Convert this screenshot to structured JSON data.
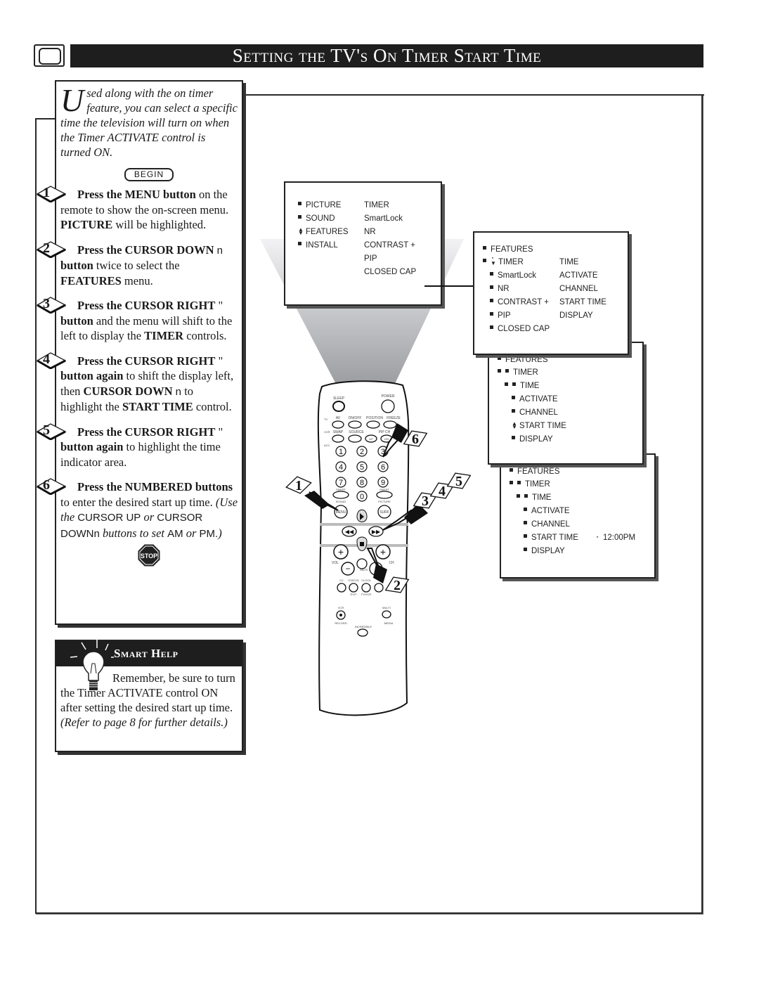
{
  "header": {
    "title": "Setting the TV's On Timer Start Time",
    "icon": "tv-icon"
  },
  "intro": {
    "dropcap": "U",
    "text": "sed along with the on timer feature, you can select a specific time the television will turn on when the Timer ACTIVATE control is turned ON.",
    "begin_label": "BEGIN"
  },
  "steps": [
    {
      "number": "1",
      "segments": [
        {
          "b": "Press the MENU button"
        },
        {
          "t": " on the remote to show the on-screen menu. "
        },
        {
          "b": "PICTURE"
        },
        {
          "t": " will be highlighted."
        }
      ]
    },
    {
      "number": "2",
      "segments": [
        {
          "b": "Press the CURSOR DOWN"
        },
        {
          "s": " n "
        },
        {
          "b": "button"
        },
        {
          "t": " twice to select the "
        },
        {
          "b": "FEATURES"
        },
        {
          "t": " menu."
        }
      ]
    },
    {
      "number": "3",
      "segments": [
        {
          "b": "Press the CURSOR RIGHT"
        },
        {
          "t": " \"      "
        },
        {
          "b": "button"
        },
        {
          "t": " and the menu will shift to the left to display the "
        },
        {
          "b": "TIMER"
        },
        {
          "t": " controls."
        }
      ]
    },
    {
      "number": "4",
      "segments": [
        {
          "b": "Press the CURSOR RIGHT"
        },
        {
          "t": " \"      "
        },
        {
          "b": "button again"
        },
        {
          "t": " to shift the display left, then "
        },
        {
          "b": "CURSOR DOWN"
        },
        {
          "s": " n "
        },
        {
          "t": " to highlight the "
        },
        {
          "b": "START TIME"
        },
        {
          "t": " control."
        }
      ]
    },
    {
      "number": "5",
      "segments": [
        {
          "b": "Press the CURSOR RIGHT"
        },
        {
          "t": " \"      "
        },
        {
          "b": "button again"
        },
        {
          "t": " to highlight the time indicator area."
        }
      ]
    },
    {
      "number": "6",
      "segments": [
        {
          "b": "Press the NUMBERED buttons"
        },
        {
          "t": " to enter the desired start up time. "
        },
        {
          "i": "(Use the "
        },
        {
          "s": "CURSOR UP"
        },
        {
          "i": "    or "
        },
        {
          "s": "CURSOR DOWNn"
        },
        {
          "i": "  buttons to set "
        },
        {
          "s": "AM"
        },
        {
          "i": " or "
        },
        {
          "s": "PM."
        },
        {
          "i": ")"
        }
      ]
    }
  ],
  "stop_label": "STOP",
  "smart_help": {
    "title": "Smart Help",
    "segments": [
      {
        "t": "Remember, be sure to turn the Timer ACTIVATE control ON after setting the desired start up time. "
      },
      {
        "i": "(Refer to page 8 for further details.)"
      }
    ]
  },
  "menus": {
    "main": {
      "left": [
        "PICTURE",
        "SOUND",
        "FEATURES",
        "INSTALL"
      ],
      "right": [
        "TIMER",
        "SmartLock",
        "NR",
        "CONTRAST +",
        "PIP",
        "CLOSED CAP"
      ],
      "selected": "FEATURES"
    },
    "features": {
      "header": "FEATURES",
      "left": [
        "TIMER",
        "SmartLock",
        "NR",
        "CONTRAST +",
        "PIP",
        "CLOSED CAP"
      ],
      "right": [
        "TIME",
        "ACTIVATE",
        "CHANNEL",
        "START TIME",
        "DISPLAY"
      ],
      "selected": "TIMER"
    },
    "timer": {
      "path": [
        "FEATURES",
        "TIMER"
      ],
      "items": [
        "TIME",
        "ACTIVATE",
        "CHANNEL",
        "START TIME",
        "DISPLAY"
      ],
      "selected": "START TIME"
    },
    "start_time": {
      "path": [
        "FEATURES",
        "TIMER"
      ],
      "items": [
        "TIME",
        "ACTIVATE",
        "CHANNEL",
        "START TIME",
        "DISPLAY"
      ],
      "selected": "START TIME",
      "value": "12:00PM"
    }
  },
  "remote": {
    "labels": {
      "sleep": "SLEEP",
      "power": "POWER",
      "tv": "TV",
      "vcr": "VCR",
      "acc": "ACC",
      "av": "AV",
      "onoff": "ON/OFF",
      "position": "POSITION",
      "freeze": "FREEZE",
      "swap": "SWAP",
      "source": "SOURCE",
      "pipch": "PIP CH",
      "up": "UP",
      "dn": "DN",
      "smart_sound_top": "SMART",
      "smart_sound_bottom": "SOUND",
      "smart_picture_top": "SMART",
      "smart_picture_bottom": "PICTURE",
      "menu": "MENU",
      "surf": "SURF",
      "vol": "VOL",
      "ch": "CH",
      "mute": "MUTE",
      "cc": "CC",
      "status": "STATUS",
      "exit": "EXIT",
      "clock": "CLOCK",
      "tvvcr": "TV/VCR",
      "vcr_record_top": "VCR",
      "vcr_record_bottom": "RECORD",
      "multi_top": "MULTI",
      "multi_bottom": "MEDIA",
      "incredible": "INCREDIBLE"
    },
    "digits": [
      "1",
      "2",
      "3",
      "4",
      "5",
      "6",
      "7",
      "8",
      "9",
      "0"
    ],
    "callouts": [
      "1",
      "2",
      "3",
      "4",
      "5",
      "6"
    ]
  }
}
